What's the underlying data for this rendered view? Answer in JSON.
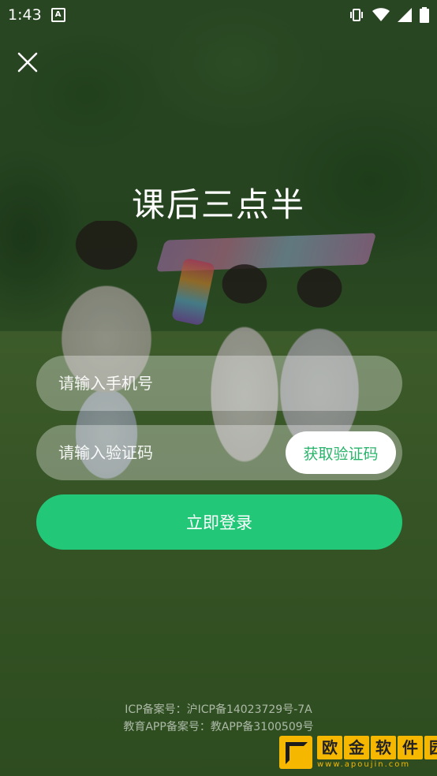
{
  "status_bar": {
    "time": "1:43"
  },
  "app": {
    "title": "课后三点半"
  },
  "form": {
    "phone_placeholder": "请输入手机号",
    "code_placeholder": "请输入验证码",
    "get_code_label": "获取验证码",
    "login_label": "立即登录"
  },
  "footer": {
    "icp": "ICP备案号：沪ICP备14023729号-7A",
    "edu": "教育APP备案号：教APP备3100509号"
  },
  "watermark": {
    "chars": [
      "欧",
      "金",
      "软",
      "件",
      "园"
    ],
    "url": "www.apoujin.com"
  },
  "colors": {
    "accent": "#22c877",
    "get_code_text": "#2ab46b"
  }
}
